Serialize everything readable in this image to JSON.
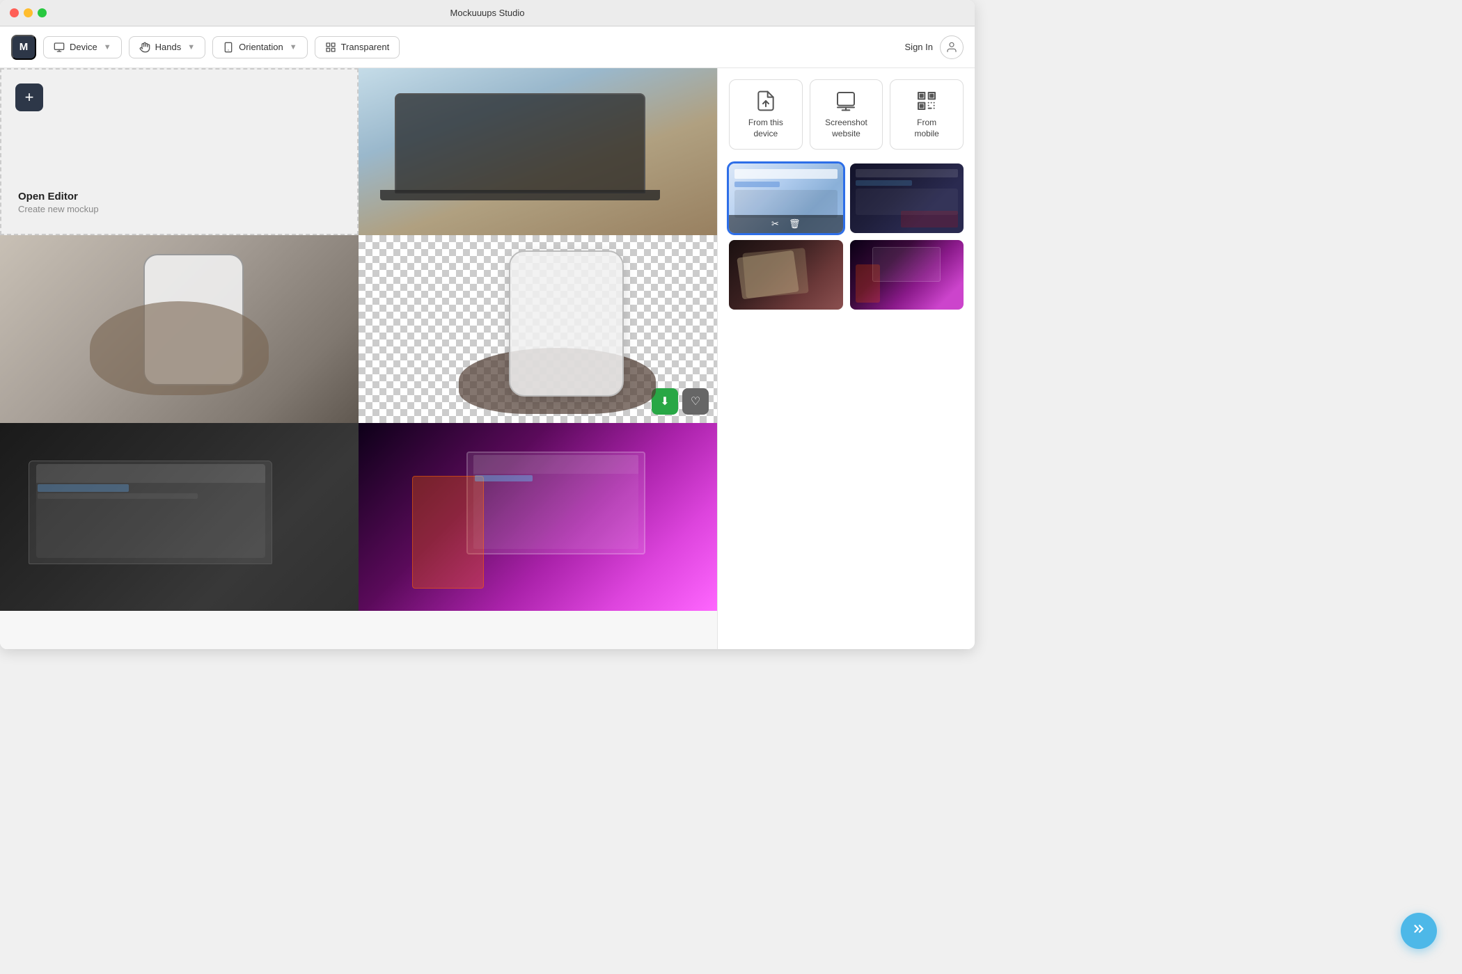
{
  "app": {
    "title": "Mockuuups Studio"
  },
  "toolbar": {
    "logo_label": "M",
    "device_label": "Device",
    "hands_label": "Hands",
    "orientation_label": "Orientation",
    "transparent_label": "Transparent",
    "sign_in_label": "Sign In"
  },
  "grid": {
    "add_new_title": "Open Editor",
    "add_new_subtitle": "Create new mockup",
    "cells": [
      {
        "id": "add-new",
        "type": "add-new"
      },
      {
        "id": "laptop-desk",
        "type": "laptop-desk"
      },
      {
        "id": "phone-hand-dark",
        "type": "phone-hand-dark"
      },
      {
        "id": "phone-transparent",
        "type": "phone-transparent",
        "selected": true
      },
      {
        "id": "laptop-dark",
        "type": "laptop-dark"
      },
      {
        "id": "monitor-purple",
        "type": "monitor-purple"
      }
    ]
  },
  "overlay_buttons": {
    "download": "⬇",
    "heart": "♡"
  },
  "sidebar": {
    "upload_options": [
      {
        "id": "from-device",
        "icon": "upload-file",
        "label": "From this\ndevice"
      },
      {
        "id": "screenshot-website",
        "icon": "screenshot",
        "label": "Screenshot\nwebsite"
      },
      {
        "id": "from-mobile",
        "icon": "qr-code",
        "label": "From\nmobile"
      }
    ],
    "thumbnails": [
      {
        "id": "thumb-1",
        "type": "light-ui",
        "selected": true
      },
      {
        "id": "thumb-2",
        "type": "dark-ui"
      },
      {
        "id": "thumb-3",
        "type": "gun-dark"
      },
      {
        "id": "thumb-4",
        "type": "purple-monitor"
      }
    ]
  },
  "fab": {
    "icon": "chevrons-right",
    "label": ">>"
  }
}
